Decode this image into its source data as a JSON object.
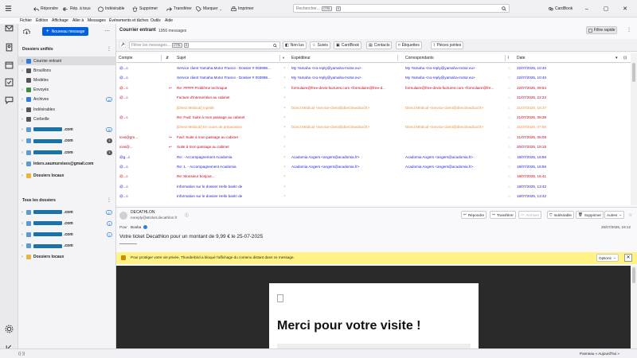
{
  "toolbar": {
    "reply": "Répondre",
    "reply_all": "Rép. à tous",
    "junk": "Indésirable",
    "delete": "Supprimer",
    "tag": "Marquer",
    "forward": "Transférer",
    "print": "Imprimer",
    "search_placeholder": "Rechercher...",
    "search_kbd1": "CTRL",
    "search_kbd2": "K",
    "cardbook": "CardBook"
  },
  "menu": [
    "Fichier",
    "Édition",
    "Affichage",
    "Aller à",
    "Messages",
    "Événements et tâches",
    "Outils",
    "Aide"
  ],
  "folder_pane": {
    "new_message": "Nouveau message",
    "unified_heading": "Dossiers unifiés",
    "unified": [
      {
        "label": "Courrier entrant",
        "icon": "inbox-icon",
        "selected": true,
        "count": "",
        "expand": true
      },
      {
        "label": "Brouillons",
        "icon": "drafts-icon",
        "selected": false,
        "count": "",
        "expand": true
      },
      {
        "label": "Modèles",
        "icon": "templates-icon",
        "selected": false,
        "count": "",
        "expand": false
      },
      {
        "label": "Envoyés",
        "icon": "sent-icon",
        "selected": false,
        "count": "",
        "expand": true
      },
      {
        "label": "Archives",
        "icon": "archive-icon",
        "selected": false,
        "count": "12",
        "expand": true
      },
      {
        "label": "Indésirables",
        "icon": "junk-icon",
        "selected": false,
        "count": "",
        "expand": true
      },
      {
        "label": "Corbeille",
        "icon": "trash-icon",
        "selected": false,
        "count": "",
        "expand": true
      }
    ],
    "accounts_unified": [
      {
        "label": ".com",
        "count": "26",
        "type": "blue"
      },
      {
        "label": ".com",
        "count": "5",
        "type": "grey"
      },
      {
        "label": ".com",
        "count": "5",
        "type": "grey"
      },
      {
        "label": "lnters.saumuroises@gmail.com",
        "count": "",
        "type": ""
      },
      {
        "label": "Dossiers locaux",
        "count": "",
        "type": ""
      }
    ],
    "all_heading": "Tous les dossiers",
    "accounts_all": [
      {
        "label": ".com",
        "count": "27",
        "type": "blue"
      },
      {
        "label": ".com",
        "count": "5",
        "type": "blue"
      },
      {
        "label": ".com",
        "count": "5",
        "type": "blue"
      },
      {
        "label": ".com",
        "count": "",
        "type": ""
      },
      {
        "label": "Dossiers locaux",
        "count": "",
        "type": ""
      }
    ]
  },
  "list_header": {
    "folder": "Courrier entrant",
    "count": "1956 messages",
    "quick_filter": "Filtre rapide",
    "filter_placeholder": "Filtrer les messages...",
    "filter_kbd1": "CTRL",
    "filter_kbd2": "K",
    "unread": "Non lus",
    "starred": "Suivis",
    "cardbook": "CardBook",
    "contacts": "Contacts",
    "tags": "Étiquettes",
    "attachments": "Pièces jointes"
  },
  "columns": {
    "account": "Compte",
    "subject": "Sujet",
    "sender": "Expéditeur",
    "correspondents": "Correspondants",
    "date": "Date"
  },
  "threads": [
    {
      "account": "@...c",
      "subject": "Service client Yamaha Motor France - Dossier # 003998...",
      "sender": "My Yamaha <no-reply@yamaha-motor.eu>",
      "corr": "My Yamaha <no-reply@yamaha-motor.eu>",
      "date": "22/07/2025, 10:40",
      "color": "#1a1ad0",
      "prefix": ""
    },
    {
      "account": "@...c",
      "subject": "Service client Yamaha Motor France - Dossier # 003998...",
      "sender": "My Yamaha <no-reply@yamaha-motor.eu>",
      "corr": "My Yamaha <no-reply@yamaha-motor.eu>",
      "date": "22/07/2025, 10:40",
      "color": "#1a1ad0",
      "prefix": ""
    },
    {
      "account": "@...c",
      "subject": "Re: ##### Problème technique",
      "sender": "formulaire@free-devis-factures.com <formulaire@free-d...",
      "corr": "formulaire@free-devis-factures.com <formulaire@fre...",
      "date": "22/07/2025, 09:54",
      "color": "#c8001a",
      "prefix": "↩"
    },
    {
      "account": "@...c",
      "subject": "Facture d'intervention au cabinet",
      "sender": "",
      "corr": "",
      "date": "21/07/2025, 22:22",
      "color": "#c8001a",
      "prefix": ""
    },
    {
      "account": "",
      "subject": "[Direct Médical] Inpédir",
      "sender": "Direct Médical <service-client@directmedical.fr>",
      "corr": "Direct Médical <service-client@directmedical.fr>",
      "date": "21/07/2025, 15:37",
      "color": "#e8913a",
      "prefix": ""
    },
    {
      "account": "@...c",
      "subject": "Re: Fwd: Suite à mon passage au cabinet",
      "sender": "",
      "corr": "",
      "date": "21/07/2025, 08:38",
      "color": "#c8001a",
      "prefix": ""
    },
    {
      "account": "",
      "subject": "[Direct Médical] En cours de préparation",
      "sender": "Direct Médical <service-client@directmedical.fr>",
      "corr": "Direct Médical <service-client@directmedical.fr>",
      "date": "21/07/2025, 07:56",
      "color": "#e8913a",
      "prefix": ""
    },
    {
      "account": "ices@gm...",
      "subject": "Fwd: Suite à mon passage au cabinet",
      "sender": "",
      "corr": "",
      "date": "21/07/2025, 05:08",
      "color": "#c8001a",
      "prefix": "↪"
    },
    {
      "account": "ices@...",
      "subject": "Suite à mon passage au cabinet",
      "sender": "",
      "corr": "",
      "date": "20/07/2025, 19:16",
      "color": "#c8001a",
      "prefix": "↩"
    },
    {
      "account": "@g...c",
      "subject": "Re:      - Accompagnement Acadomia",
      "sender": "Acadomia Angers <angers@acadomia.fr>",
      "corr": "Acadomia Angers <angers@acadomia.fr>",
      "date": "18/07/2025, 16:56",
      "color": "#1a1ad0",
      "prefix": ""
    },
    {
      "account": "@...c",
      "subject": "Re: 1.        - Accompagnement Acadomia",
      "sender": "Acadomia Angers <angers@acadomia.fr>",
      "corr": "Acadomia Angers <angers@acadomia.fr>",
      "date": "18/07/2025, 16:56",
      "color": "#1a1ad0",
      "prefix": ""
    },
    {
      "account": "@...c",
      "subject": "Re: Monsieur       bonjour...",
      "sender": "",
      "corr": "",
      "date": "18/07/2025, 16:41",
      "color": "#c8001a",
      "prefix": ""
    },
    {
      "account": "@...c",
      "subject": "Information sur le dossier Hello bank! de",
      "sender": "",
      "corr": "",
      "date": "18/07/2025, 13:42",
      "color": "#1a1ad0",
      "prefix": ""
    },
    {
      "account": "@...c",
      "subject": "Information sur le dossier Hello bank! de",
      "sender": "",
      "corr": "",
      "date": "18/07/2025, 13:42",
      "color": "#1a1ad0",
      "prefix": ""
    }
  ],
  "message": {
    "from_name": "DECATHLON",
    "from_addr": "noreply@eticket.decathlon.fr",
    "to_label": "Pour",
    "to_name": "Booba",
    "date": "25/07/2025, 19:12",
    "subject": "Votre ticket Decathlon pour un montant de 9,99 € le 25-07-2025",
    "reply": "Répondre",
    "forward": "Transférer",
    "archive": "Archiver",
    "junk": "Indésirable",
    "delete": "Supprimer",
    "other": "Autres"
  },
  "notification": {
    "text": "Pour protéger votre vie privée, Thunderbird a bloqué l'affichage du contenu distant dans ce message.",
    "options": "Options"
  },
  "email_body": {
    "heading": "Merci pour votre visite !"
  },
  "statusbar": {
    "today": "Panneau « Aujourd'hui »"
  },
  "colors": {
    "accent": "#0061e0",
    "unread_blue": "#1a1ad0",
    "red_tag": "#c8001a",
    "orange_tag": "#e8913a",
    "notification": "#fff386"
  }
}
